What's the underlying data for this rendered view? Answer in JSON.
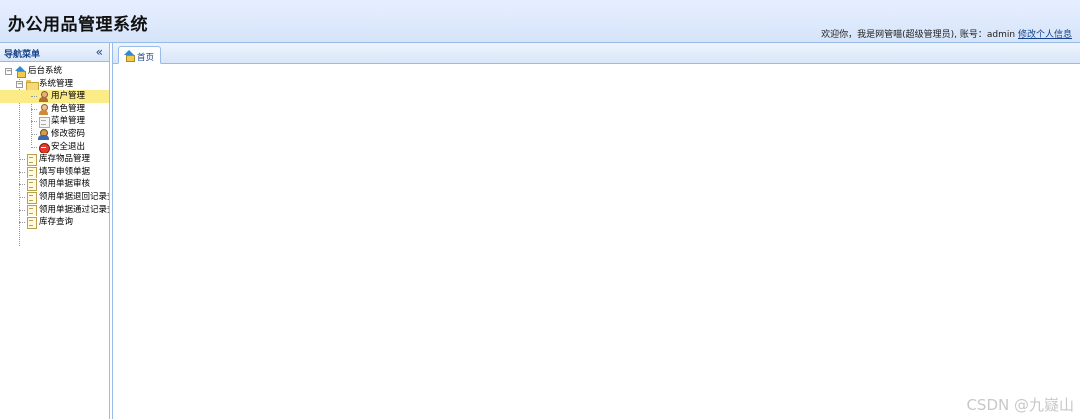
{
  "header": {
    "title": "办公用品管理系统",
    "welcome_text": "欢迎你，我是网管喵(超级管理员), 账号：admin",
    "edit_profile_link": "修改个人信息"
  },
  "nav": {
    "title": "导航菜单",
    "tree": {
      "root": "后台系统",
      "system_folder": "系统管理",
      "system_items": [
        {
          "label": "用户管理",
          "icon": "user-icon"
        },
        {
          "label": "角色管理",
          "icon": "role-icon"
        },
        {
          "label": "菜单管理",
          "icon": "menu-icon"
        },
        {
          "label": "修改密码",
          "icon": "key-user-icon"
        },
        {
          "label": "安全退出",
          "icon": "exit-icon"
        }
      ],
      "top_items": [
        "库存物品管理",
        "填写申领单据",
        "领用单据审核",
        "领用单据退回记录查询",
        "领用单据通过记录查询",
        "库存查询"
      ]
    }
  },
  "tabs": [
    {
      "label": "首页",
      "icon": "home-icon"
    }
  ],
  "watermark": "CSDN @九嶷山",
  "colors": {
    "header_bg": "#dbe7fb",
    "border": "#99bbe8",
    "selected_bg": "#fbec88",
    "link": "#15428b"
  }
}
